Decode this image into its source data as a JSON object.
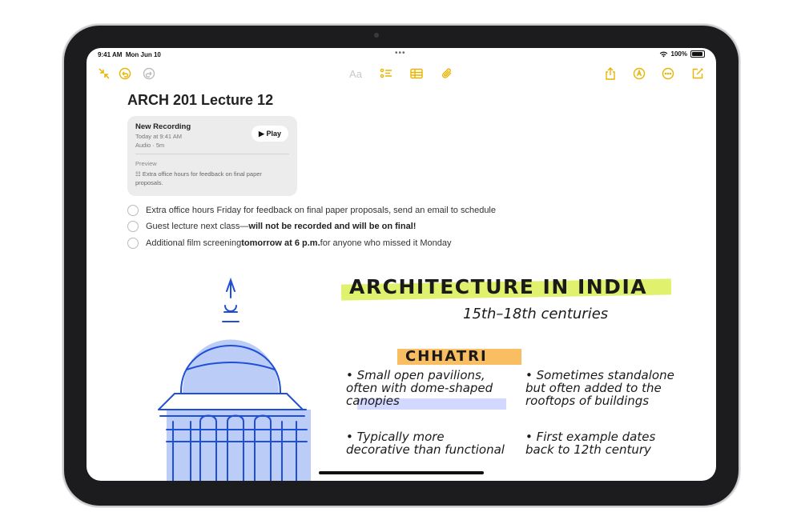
{
  "status": {
    "time": "9:41 AM",
    "date": "Mon Jun 10",
    "battery": "100%"
  },
  "toolbar": {
    "format_label": "Aa",
    "icons": [
      "collapse-icon",
      "undo-icon",
      "redo-icon",
      "checklist-icon",
      "table-icon",
      "attachment-icon",
      "share-icon",
      "markup-icon",
      "more-icon",
      "compose-icon"
    ]
  },
  "note": {
    "title": "ARCH 201 Lecture 12",
    "recording": {
      "name": "New Recording",
      "date": "Today at 9:41 AM",
      "meta": "Audio · 5m",
      "play_label": "▶ Play",
      "preview_label": "Preview",
      "preview_text": "Extra office hours for feedback on final paper proposals."
    },
    "checklist": [
      {
        "pre": "Extra office hours Friday for feedback on final paper proposals, send an email to schedule",
        "bold": "",
        "post": ""
      },
      {
        "pre": "Guest lecture next class—",
        "bold": "will not be recorded and will be on final!",
        "post": ""
      },
      {
        "pre": "Additional film screening ",
        "bold": "tomorrow at 6 p.m.",
        "post": " for anyone who missed it Monday"
      }
    ]
  },
  "handwriting": {
    "heading": "ARCHITECTURE IN INDIA",
    "subheading": "15th–18th centuries",
    "section": "CHHATRI",
    "bullets": [
      "Small open pavilions, often with dome-shaped canopies",
      "Sometimes standalone but often added to the rooftops of buildings",
      "Typically more decorative than functional",
      "First example dates back to 12th century"
    ]
  },
  "colors": {
    "accent": "#e8b400",
    "highlight_yellow": "#d6ec3c",
    "highlight_orange": "#f8b246",
    "sketch_blue": "#1f4fd6"
  }
}
